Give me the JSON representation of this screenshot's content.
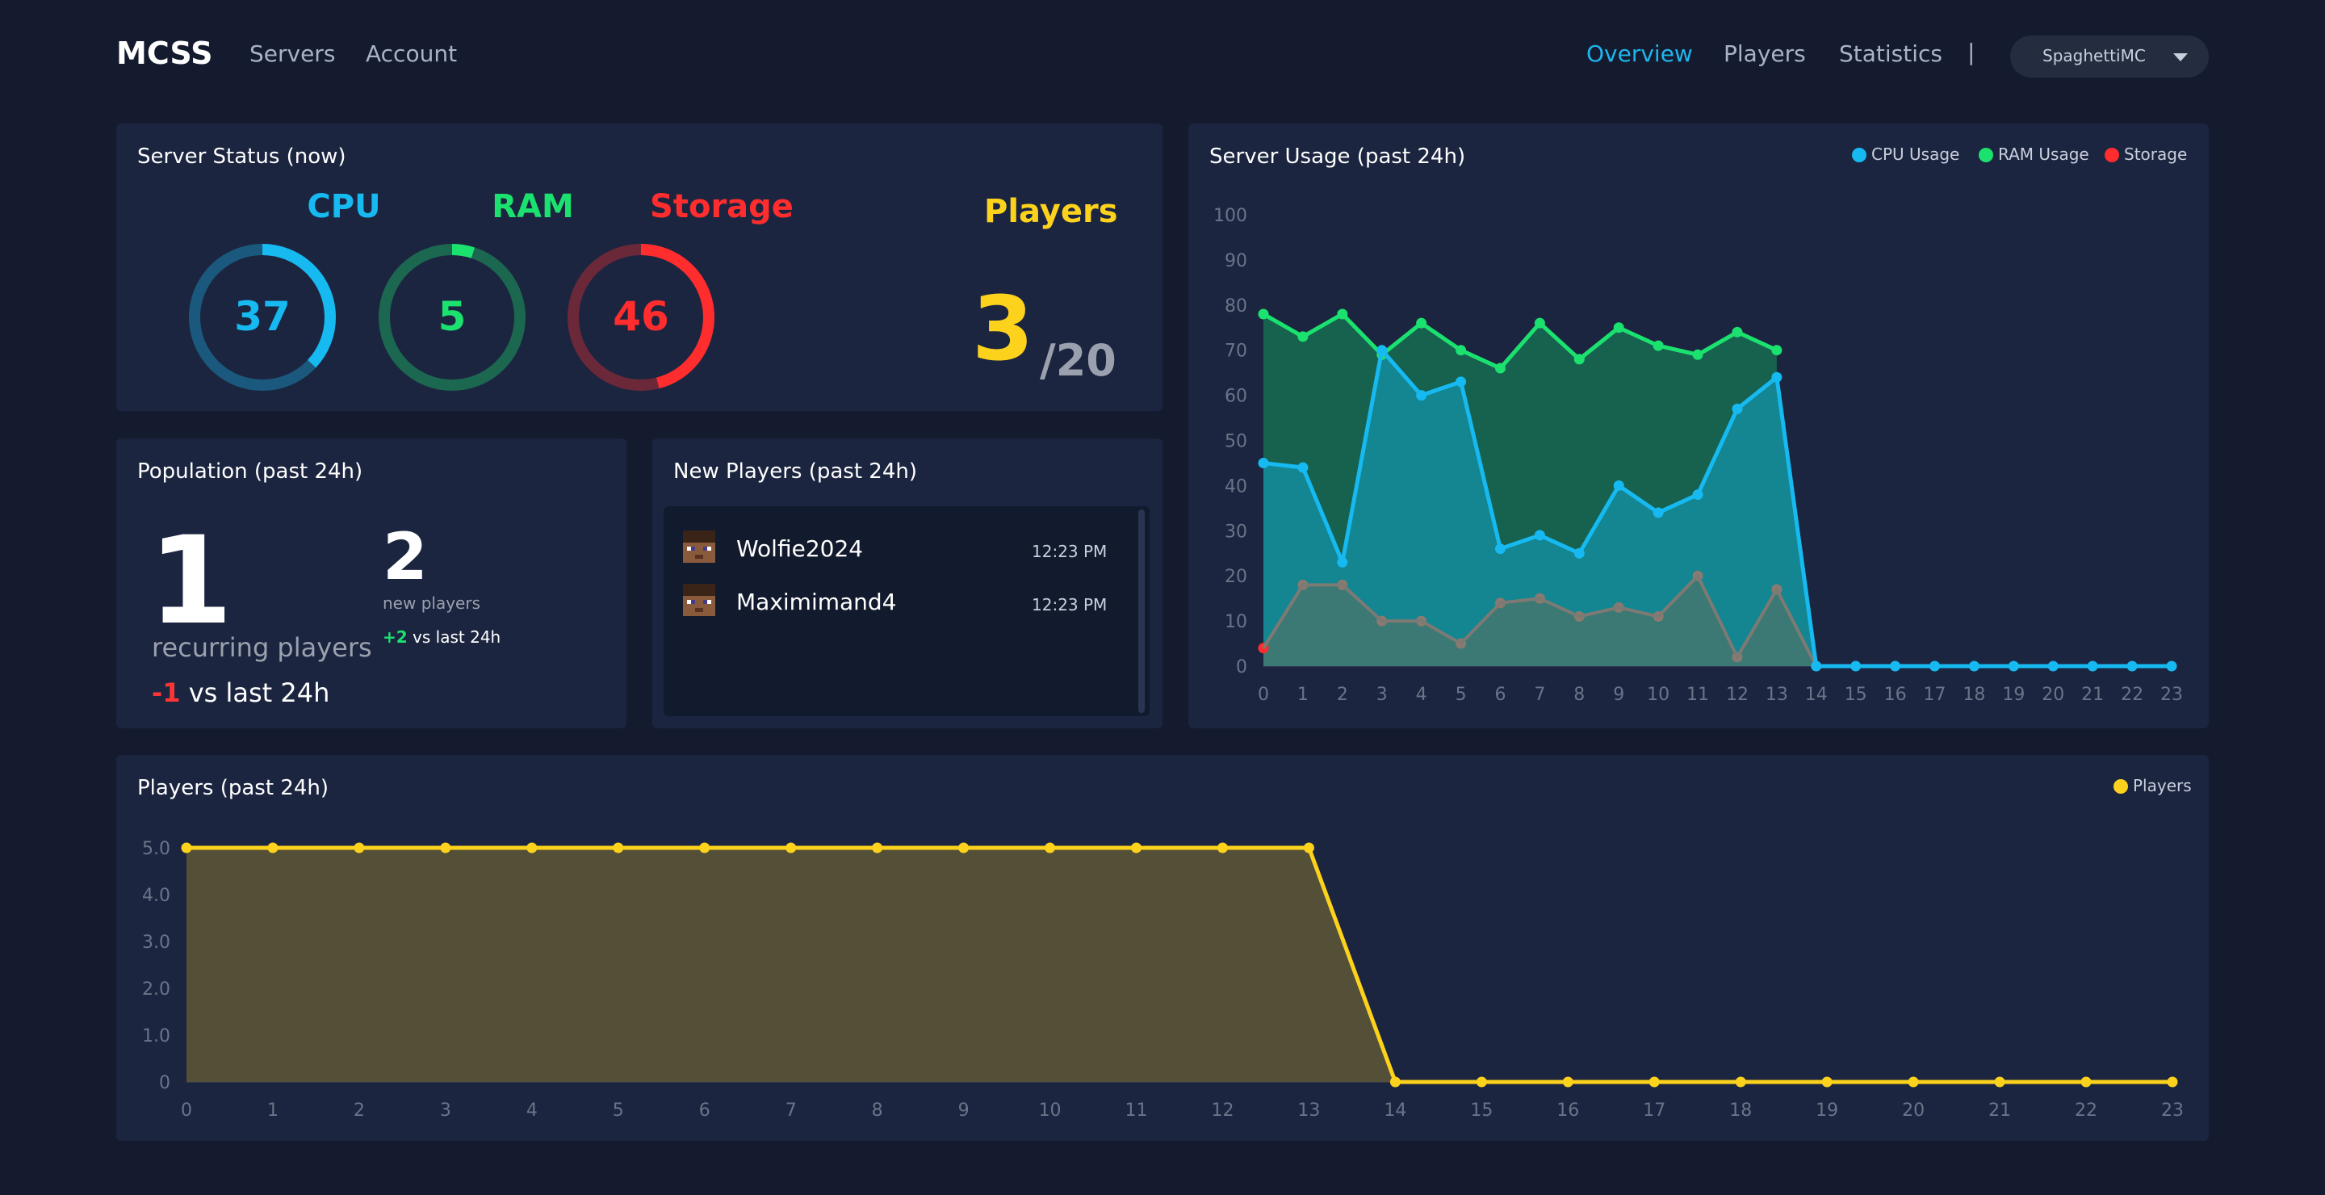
{
  "nav": {
    "brand": "MCSS",
    "links": [
      "Servers",
      "Account"
    ],
    "tabs": [
      "Overview",
      "Players",
      "Statistics"
    ],
    "separator": "|",
    "user": "SpaghettiMC"
  },
  "status": {
    "title": "Server Status (now)",
    "cpu": {
      "label": "CPU",
      "value": 37,
      "color": "#16b9f0"
    },
    "ram": {
      "label": "RAM",
      "value": 5,
      "color": "#1be16f"
    },
    "storage": {
      "label": "Storage",
      "value": 46,
      "color": "#ff2d2d"
    },
    "players": {
      "label": "Players",
      "count": "3",
      "max": "/20",
      "color": "#fdd21c"
    }
  },
  "population": {
    "title": "Population (past 24h)",
    "recurring": "1",
    "recurring_label": "recurring players",
    "recurring_diff": "-1",
    "recurring_diff_label": " vs last 24h",
    "new": "2",
    "new_label": "new players",
    "new_diff": "+2",
    "new_diff_label": " vs last 24h"
  },
  "new_players": {
    "title": "New Players (past 24h)",
    "items": [
      {
        "name": "Wolfie2024",
        "time": "12:23 PM"
      },
      {
        "name": "Maximimand4",
        "time": "12:23 PM"
      }
    ]
  },
  "usage": {
    "title": "Server Usage (past 24h)",
    "legend": [
      "CPU Usage",
      "RAM Usage",
      "Storage"
    ]
  },
  "players_chart": {
    "title": "Players (past 24h)",
    "legend": "Players"
  },
  "chart_data": [
    {
      "type": "area",
      "title": "Server Usage (past 24h)",
      "x": [
        0,
        1,
        2,
        3,
        4,
        5,
        6,
        7,
        8,
        9,
        10,
        11,
        12,
        13,
        14,
        15,
        16,
        17,
        18,
        19,
        20,
        21,
        22,
        23
      ],
      "ylim": [
        0,
        100
      ],
      "yticks": [
        0,
        10,
        20,
        30,
        40,
        50,
        60,
        70,
        80,
        90,
        100
      ],
      "legend_position": "top-right",
      "series": [
        {
          "name": "CPU Usage",
          "color": "#16b9f0",
          "fill": "#138691",
          "values": [
            45,
            44,
            23,
            70,
            60,
            63,
            26,
            29,
            25,
            40,
            34,
            38,
            57,
            64,
            0,
            0,
            0,
            0,
            0,
            0,
            0,
            0,
            0,
            0
          ]
        },
        {
          "name": "RAM Usage",
          "color": "#1be16f",
          "fill": "#16624f",
          "values": [
            78,
            73,
            78,
            69,
            76,
            70,
            66,
            76,
            68,
            75,
            71,
            69,
            74,
            70
          ]
        },
        {
          "name": "Storage",
          "color": "#ff2d2d",
          "fill": "#3c7874",
          "markColor": "#8a7a70",
          "values": [
            4,
            18,
            18,
            10,
            10,
            5,
            14,
            15,
            11,
            13,
            11,
            20,
            2,
            17,
            0
          ]
        }
      ]
    },
    {
      "type": "area",
      "title": "Players (past 24h)",
      "x": [
        0,
        1,
        2,
        3,
        4,
        5,
        6,
        7,
        8,
        9,
        10,
        11,
        12,
        13,
        14,
        15,
        16,
        17,
        18,
        19,
        20,
        21,
        22,
        23
      ],
      "ylim": [
        0,
        5
      ],
      "yticks": [
        "0",
        "1.0",
        "2.0",
        "3.0",
        "4.0",
        "5.0"
      ],
      "legend_position": "top-right",
      "series": [
        {
          "name": "Players",
          "color": "#fdd21c",
          "fill": "#545037",
          "values": [
            5,
            5,
            5,
            5,
            5,
            5,
            5,
            5,
            5,
            5,
            5,
            5,
            5,
            5,
            0,
            0,
            0,
            0,
            0,
            0,
            0,
            0,
            0,
            0
          ]
        }
      ]
    }
  ]
}
